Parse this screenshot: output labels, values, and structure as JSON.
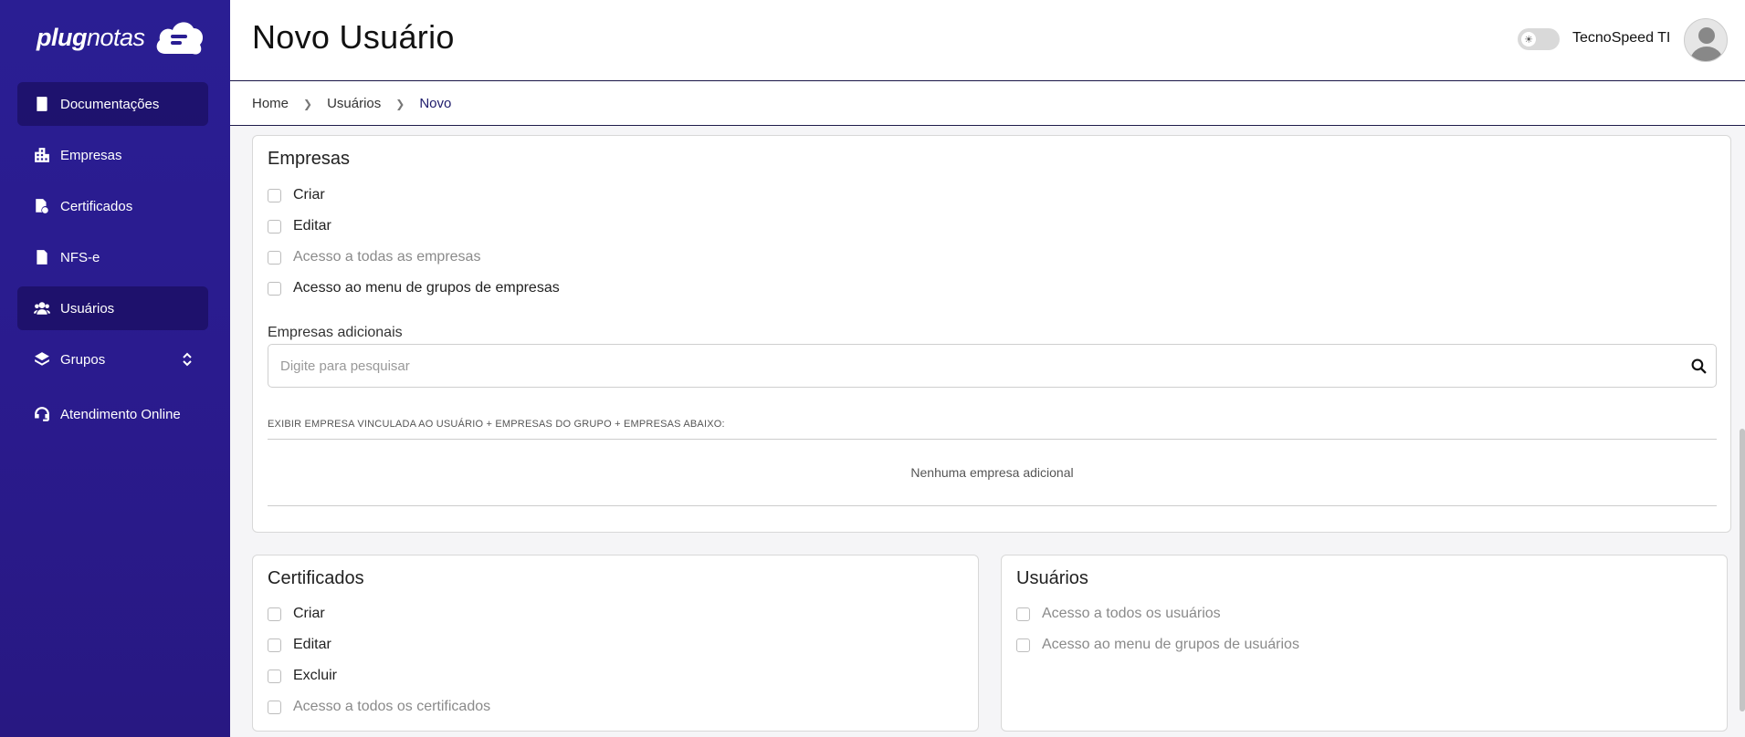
{
  "sidebar": {
    "logo": {
      "bold": "plug",
      "light": "notas"
    },
    "items": [
      {
        "label": "Documentações",
        "icon": "book-icon"
      },
      {
        "label": "Empresas",
        "icon": "building-icon"
      },
      {
        "label": "Certificados",
        "icon": "certificate-icon"
      },
      {
        "label": "NFS-e",
        "icon": "invoice-icon"
      },
      {
        "label": "Usuários",
        "icon": "users-icon"
      },
      {
        "label": "Grupos",
        "icon": "layers-icon"
      },
      {
        "label": "Atendimento Online",
        "icon": "headset-icon"
      }
    ]
  },
  "header": {
    "title": "Novo Usuário",
    "user_name": "TecnoSpeed TI"
  },
  "breadcrumb": [
    "Home",
    "Usuários",
    "Novo"
  ],
  "empresas": {
    "title": "Empresas",
    "options": [
      "Criar",
      "Editar",
      "Acesso a todas as empresas",
      "Acesso ao menu de grupos de empresas"
    ],
    "additional_label": "Empresas adicionais",
    "search_placeholder": "Digite para pesquisar",
    "note": "EXIBIR EMPRESA VINCULADA AO USUÁRIO + EMPRESAS DO GRUPO + EMPRESAS ABAIXO:",
    "empty_message": "Nenhuma empresa adicional"
  },
  "certificados": {
    "title": "Certificados",
    "options": [
      "Criar",
      "Editar",
      "Excluir",
      "Acesso a todos os certificados"
    ]
  },
  "usuarios": {
    "title": "Usuários",
    "options": [
      "Acesso a todos os usuários",
      "Acesso ao menu de grupos de usuários"
    ]
  },
  "colors": {
    "sidebar_bg": "#2a1e93",
    "active_item_bg": "#1e1360",
    "border_accent": "#1e1b4b"
  }
}
